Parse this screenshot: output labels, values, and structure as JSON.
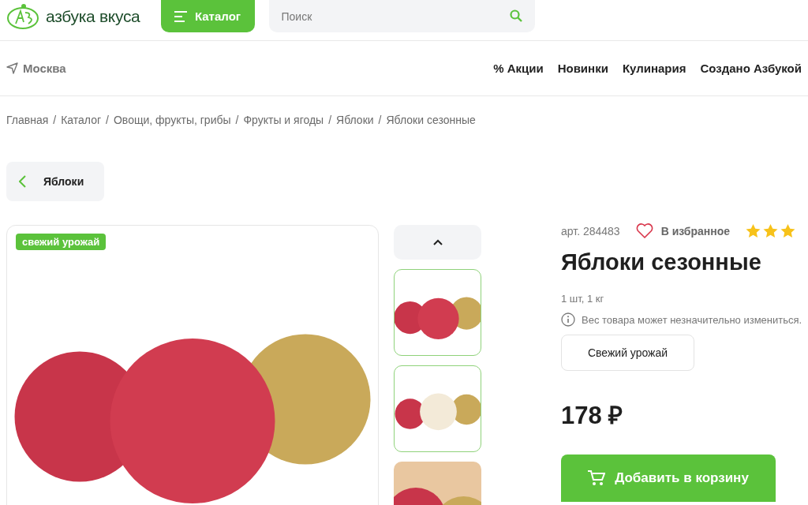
{
  "header": {
    "logo_text": "азбука вкуса",
    "catalog_button": "Каталог",
    "search": {
      "placeholder": "Поиск"
    }
  },
  "location": "Москва",
  "nav": [
    "% Акции",
    "Новинки",
    "Кулинария",
    "Создано Азбукой"
  ],
  "breadcrumbs": [
    {
      "label": "Главная",
      "separator": "/"
    },
    {
      "label": "Каталог",
      "separator": "/"
    },
    {
      "label": "Овощи, фрукты, грибы",
      "separator": "/"
    },
    {
      "label": "Фрукты и ягоды",
      "separator": "/"
    },
    {
      "label": "Яблоки",
      "separator": "/"
    },
    {
      "label": "Яблоки сезонные"
    }
  ],
  "back_button": "Яблоки",
  "gallery": {
    "badge": "свежий урожай",
    "thumbnails": [
      {
        "kind": "whole"
      },
      {
        "kind": "cut"
      },
      {
        "kind": "closeup"
      }
    ]
  },
  "product": {
    "article": "арт. 284483",
    "favorite": "В избранное",
    "stars": 3,
    "title": "Яблоки сезонные",
    "pack": "1 шт, 1 кг",
    "note": "Вес товара может незначительно измениться.",
    "tag": "Свежий урожай",
    "price": "178 ₽",
    "add_to_cart": "Добавить в корзину"
  }
}
